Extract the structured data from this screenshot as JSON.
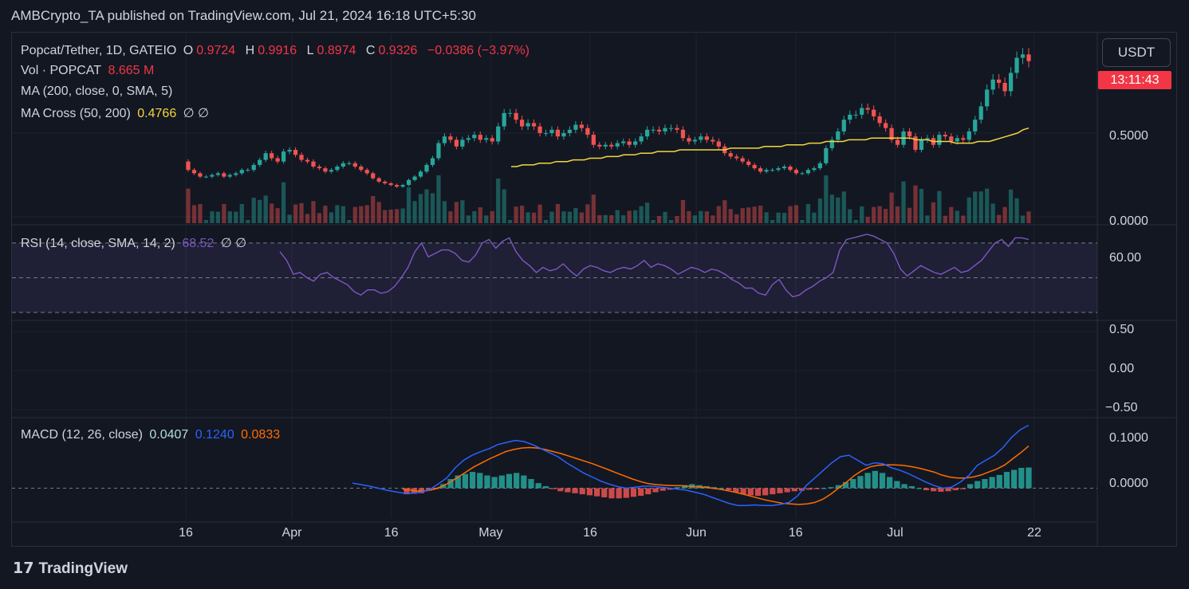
{
  "header": {
    "text": "AMBCrypto_TA published on TradingView.com, Jul 21, 2024 16:18 UTC+5:30"
  },
  "legend": {
    "symbol": "Popcat/Tether, 1D, GATEIO",
    "open_label": "O",
    "open": "0.9724",
    "high_label": "H",
    "high": "0.9916",
    "low_label": "L",
    "low": "0.8974",
    "close_label": "C",
    "close": "0.9326",
    "change": "−0.0386 (−3.97%)",
    "vol_label": "Vol · POPCAT",
    "vol": "8.665 M",
    "ma_label": "MA (200, close, 0, SMA, 5)",
    "macross_label": "MA Cross (50, 200)",
    "macross_value": "0.4766",
    "macross_extra": "∅ ∅",
    "rsi_label": "RSI (14, close, SMA, 14, 2)",
    "rsi_value": "68.52",
    "rsi_extra": "∅ ∅",
    "macd_label": "MACD (12, 26, close)",
    "macd_hist": "0.0407",
    "macd_line": "0.1240",
    "macd_signal": "0.0833"
  },
  "currency": "USDT",
  "countdown": "13:11:43",
  "price_axis": [
    "0.5000",
    "0.0000"
  ],
  "rsi_axis": [
    "60.00"
  ],
  "mid_axis": [
    "0.50",
    "0.00",
    "−0.50"
  ],
  "macd_axis": [
    "0.1000",
    "0.0000"
  ],
  "footer": {
    "brand": "TradingView",
    "logo": "tradingview-logo-icon"
  },
  "colors": {
    "up": "#26a69a",
    "down": "#ef5350",
    "ma": "#f5d63c",
    "rsi": "#7e57c2",
    "macd": "#2962ff",
    "signal": "#ff6d00",
    "bg": "#131722",
    "grid": "#1e222d"
  },
  "chart_data": {
    "type": "candlestick",
    "x_tick_labels": [
      "16",
      "Apr",
      "16",
      "May",
      "16",
      "Jun",
      "16",
      "Jul",
      "22"
    ],
    "x_tick_dates": [
      "2024-03-16",
      "2024-04-01",
      "2024-04-16",
      "2024-05-01",
      "2024-05-16",
      "2024-06-01",
      "2024-06-16",
      "2024-07-01",
      "2024-07-22"
    ],
    "price_ylim": [
      0,
      1.0
    ],
    "rsi_ylim": [
      30,
      75
    ],
    "rsi_levels": [
      70,
      50,
      30
    ],
    "macd_ylim": [
      -0.04,
      0.12
    ],
    "candles": {
      "open": [
        0.33,
        0.28,
        0.26,
        0.24,
        0.24,
        0.25,
        0.26,
        0.24,
        0.25,
        0.26,
        0.28,
        0.28,
        0.31,
        0.34,
        0.38,
        0.35,
        0.33,
        0.39,
        0.4,
        0.37,
        0.34,
        0.33,
        0.3,
        0.29,
        0.27,
        0.28,
        0.3,
        0.32,
        0.32,
        0.3,
        0.28,
        0.26,
        0.23,
        0.21,
        0.2,
        0.19,
        0.18,
        0.19,
        0.22,
        0.24,
        0.27,
        0.31,
        0.35,
        0.44,
        0.48,
        0.46,
        0.42,
        0.46,
        0.47,
        0.49,
        0.46,
        0.47,
        0.45,
        0.54,
        0.62,
        0.62,
        0.58,
        0.54,
        0.56,
        0.54,
        0.5,
        0.5,
        0.52,
        0.48,
        0.5,
        0.52,
        0.55,
        0.53,
        0.49,
        0.43,
        0.42,
        0.43,
        0.42,
        0.44,
        0.45,
        0.43,
        0.45,
        0.48,
        0.52,
        0.52,
        0.51,
        0.53,
        0.53,
        0.52,
        0.47,
        0.45,
        0.46,
        0.48,
        0.46,
        0.45,
        0.42,
        0.38,
        0.36,
        0.35,
        0.33,
        0.31,
        0.29,
        0.27,
        0.28,
        0.28,
        0.29,
        0.3,
        0.28,
        0.26,
        0.26,
        0.28,
        0.29,
        0.32,
        0.41,
        0.46,
        0.51,
        0.58,
        0.61,
        0.61,
        0.65,
        0.64,
        0.6,
        0.56,
        0.53,
        0.46,
        0.43,
        0.51,
        0.48,
        0.4,
        0.46,
        0.47,
        0.43,
        0.49,
        0.48,
        0.45,
        0.47,
        0.46,
        0.51,
        0.58,
        0.66,
        0.76,
        0.82,
        0.8,
        0.75,
        0.86,
        0.95,
        0.97
      ],
      "close": [
        0.28,
        0.26,
        0.24,
        0.24,
        0.25,
        0.26,
        0.24,
        0.25,
        0.26,
        0.28,
        0.28,
        0.31,
        0.34,
        0.38,
        0.35,
        0.33,
        0.39,
        0.4,
        0.37,
        0.34,
        0.33,
        0.3,
        0.29,
        0.27,
        0.28,
        0.3,
        0.32,
        0.32,
        0.3,
        0.28,
        0.26,
        0.23,
        0.21,
        0.2,
        0.19,
        0.18,
        0.19,
        0.22,
        0.24,
        0.27,
        0.31,
        0.35,
        0.44,
        0.48,
        0.46,
        0.42,
        0.46,
        0.47,
        0.49,
        0.46,
        0.47,
        0.45,
        0.54,
        0.62,
        0.62,
        0.58,
        0.54,
        0.56,
        0.54,
        0.5,
        0.5,
        0.52,
        0.48,
        0.5,
        0.52,
        0.55,
        0.53,
        0.49,
        0.43,
        0.42,
        0.43,
        0.42,
        0.44,
        0.45,
        0.43,
        0.45,
        0.48,
        0.52,
        0.52,
        0.51,
        0.53,
        0.53,
        0.52,
        0.47,
        0.45,
        0.46,
        0.48,
        0.46,
        0.45,
        0.42,
        0.38,
        0.36,
        0.35,
        0.33,
        0.31,
        0.29,
        0.27,
        0.28,
        0.28,
        0.29,
        0.3,
        0.28,
        0.26,
        0.26,
        0.28,
        0.29,
        0.32,
        0.41,
        0.46,
        0.51,
        0.58,
        0.61,
        0.61,
        0.65,
        0.64,
        0.6,
        0.56,
        0.53,
        0.46,
        0.43,
        0.51,
        0.48,
        0.4,
        0.46,
        0.47,
        0.43,
        0.49,
        0.48,
        0.45,
        0.47,
        0.46,
        0.51,
        0.58,
        0.66,
        0.76,
        0.82,
        0.8,
        0.75,
        0.86,
        0.95,
        0.97,
        0.93
      ]
    },
    "ma_cross_50_200": [
      0.3,
      0.3,
      0.31,
      0.31,
      0.31,
      0.32,
      0.32,
      0.32,
      0.33,
      0.33,
      0.33,
      0.34,
      0.34,
      0.34,
      0.35,
      0.35,
      0.35,
      0.36,
      0.36,
      0.36,
      0.37,
      0.37,
      0.37,
      0.38,
      0.38,
      0.38,
      0.39,
      0.39,
      0.39,
      0.39,
      0.4,
      0.4,
      0.4,
      0.4,
      0.4,
      0.4,
      0.4,
      0.4,
      0.4,
      0.41,
      0.41,
      0.41,
      0.41,
      0.41,
      0.41,
      0.42,
      0.42,
      0.42,
      0.42,
      0.43,
      0.43,
      0.43,
      0.43,
      0.44,
      0.44,
      0.44,
      0.45,
      0.45,
      0.45,
      0.45,
      0.46,
      0.46,
      0.46,
      0.46,
      0.47,
      0.47,
      0.47,
      0.47,
      0.47,
      0.47,
      0.47,
      0.47,
      0.46,
      0.46,
      0.46,
      0.45,
      0.45,
      0.45,
      0.45,
      0.44,
      0.44,
      0.44,
      0.44,
      0.45,
      0.45,
      0.45,
      0.46,
      0.47,
      0.48,
      0.49,
      0.5,
      0.52,
      0.53
    ],
    "rsi": [
      65,
      60,
      52,
      53,
      50,
      48,
      52,
      53,
      50,
      48,
      46,
      42,
      40,
      43,
      43,
      41,
      42,
      45,
      50,
      56,
      65,
      70,
      62,
      64,
      66,
      66,
      64,
      60,
      59,
      63,
      70,
      72,
      67,
      71,
      73,
      65,
      60,
      57,
      53,
      56,
      54,
      55,
      58,
      54,
      51,
      55,
      57,
      56,
      54,
      53,
      55,
      56,
      55,
      57,
      60,
      56,
      58,
      57,
      55,
      52,
      54,
      56,
      55,
      53,
      55,
      54,
      52,
      49,
      47,
      44,
      44,
      41,
      40,
      46,
      49,
      43,
      39,
      40,
      43,
      45,
      48,
      50,
      53,
      66,
      72,
      73,
      74,
      75,
      74,
      72,
      70,
      64,
      55,
      51,
      54,
      57,
      55,
      53,
      52,
      54,
      56,
      53,
      54,
      57,
      60,
      65,
      70,
      72,
      68,
      73,
      73,
      72
    ],
    "macd_line": [
      0.01,
      0.007,
      0.004,
      0.0,
      -0.004,
      -0.007,
      -0.01,
      -0.01,
      -0.008,
      -0.003,
      0.008,
      0.02,
      0.04,
      0.055,
      0.065,
      0.072,
      0.078,
      0.086,
      0.09,
      0.094,
      0.092,
      0.086,
      0.078,
      0.07,
      0.062,
      0.05,
      0.04,
      0.03,
      0.022,
      0.014,
      0.008,
      0.003,
      0.0,
      0.002,
      0.004,
      0.004,
      0.002,
      0.0,
      -0.002,
      -0.004,
      -0.008,
      -0.012,
      -0.018,
      -0.024,
      -0.03,
      -0.034,
      -0.034,
      -0.033,
      -0.034,
      -0.034,
      -0.032,
      -0.028,
      -0.015,
      0.005,
      0.02,
      0.035,
      0.05,
      0.062,
      0.065,
      0.055,
      0.045,
      0.05,
      0.048,
      0.04,
      0.035,
      0.028,
      0.02,
      0.012,
      0.005,
      0.0,
      0.002,
      0.012,
      0.025,
      0.045,
      0.055,
      0.065,
      0.08,
      0.1,
      0.115,
      0.124
    ],
    "macd_signal": [
      -0.002,
      -0.004,
      -0.006,
      -0.005,
      -0.002,
      0.004,
      0.012,
      0.022,
      0.032,
      0.042,
      0.05,
      0.058,
      0.065,
      0.072,
      0.076,
      0.079,
      0.08,
      0.079,
      0.076,
      0.072,
      0.068,
      0.063,
      0.058,
      0.053,
      0.048,
      0.042,
      0.036,
      0.03,
      0.024,
      0.018,
      0.013,
      0.009,
      0.007,
      0.006,
      0.005,
      0.005,
      0.004,
      0.003,
      0.002,
      0.0,
      -0.002,
      -0.005,
      -0.008,
      -0.012,
      -0.016,
      -0.02,
      -0.024,
      -0.027,
      -0.03,
      -0.031,
      -0.032,
      -0.031,
      -0.028,
      -0.022,
      -0.012,
      0.0,
      0.012,
      0.025,
      0.035,
      0.042,
      0.045,
      0.046,
      0.046,
      0.045,
      0.043,
      0.04,
      0.036,
      0.032,
      0.026,
      0.022,
      0.02,
      0.02,
      0.022,
      0.026,
      0.032,
      0.038,
      0.046,
      0.058,
      0.07,
      0.083
    ],
    "macd_hist": [
      -0.012,
      -0.011,
      -0.01,
      -0.005,
      -0.002,
      0.008,
      0.018,
      0.025,
      0.028,
      0.032,
      0.03,
      0.025,
      0.022,
      0.025,
      0.028,
      0.03,
      0.025,
      0.018,
      0.01,
      0.004,
      -0.002,
      -0.006,
      -0.008,
      -0.01,
      -0.012,
      -0.014,
      -0.016,
      -0.018,
      -0.02,
      -0.02,
      -0.019,
      -0.017,
      -0.015,
      -0.012,
      -0.008,
      -0.005,
      -0.003,
      0.002,
      0.006,
      0.008,
      0.006,
      0.004,
      0.002,
      0.0,
      -0.004,
      -0.008,
      -0.012,
      -0.014,
      -0.015,
      -0.014,
      -0.012,
      -0.01,
      -0.008,
      -0.006,
      -0.005,
      -0.003,
      -0.002,
      0.0,
      0.002,
      0.006,
      0.012,
      0.018,
      0.024,
      0.03,
      0.034,
      0.03,
      0.022,
      0.014,
      0.008,
      0.004,
      0.0,
      -0.004,
      -0.006,
      -0.007,
      -0.006,
      -0.004,
      -0.002,
      0.008,
      0.014,
      0.018,
      0.022,
      0.026,
      0.032,
      0.036,
      0.04,
      0.0407
    ]
  }
}
